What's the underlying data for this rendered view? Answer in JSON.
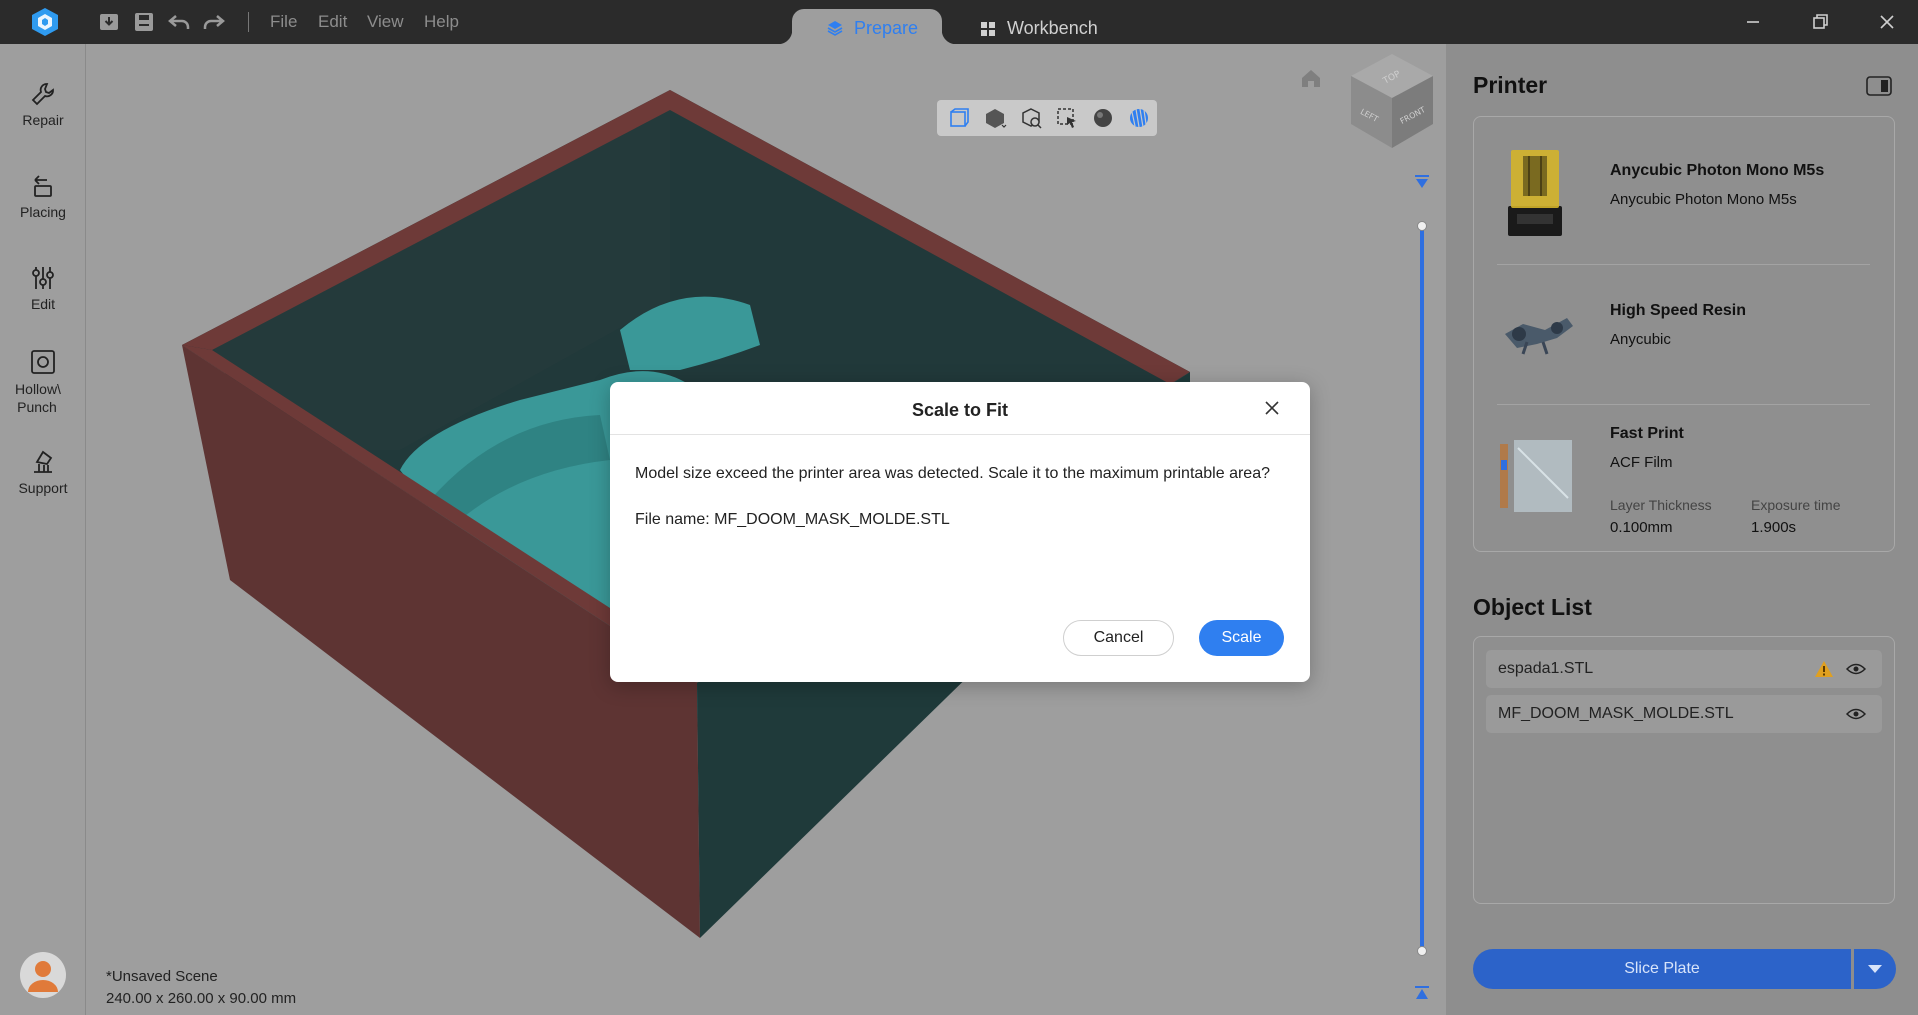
{
  "titlebar": {
    "menus": [
      "File",
      "Edit",
      "View",
      "Help"
    ],
    "tabs": {
      "prepare": "Prepare",
      "workbench": "Workbench"
    }
  },
  "left_tools": [
    {
      "label": "Repair",
      "icon": "wrench-icon"
    },
    {
      "label": "Placing",
      "icon": "placing-icon"
    },
    {
      "label": "Edit",
      "icon": "sliders-icon"
    },
    {
      "label": "Hollow\\",
      "label2": "Punch",
      "icon": "hollow-punch-icon"
    },
    {
      "label": "Support",
      "icon": "support-icon"
    }
  ],
  "viewport": {
    "view_cube": {
      "top": "TOP",
      "left": "LEFT",
      "front": "FRONT"
    },
    "scene_name": "*Unsaved Scene",
    "scene_size": "240.00 x 260.00 x 90.00 mm"
  },
  "printer": {
    "title": "Printer",
    "machine": {
      "name": "Anycubic Photon Mono M5s",
      "sub": "Anycubic Photon Mono M5s"
    },
    "resin": {
      "name": "High Speed Resin",
      "sub": "Anycubic"
    },
    "profile": {
      "name": "Fast Print",
      "sub": "ACF Film",
      "layer_label": "Layer Thickness",
      "layer_value": "0.100mm",
      "exposure_label": "Exposure time",
      "exposure_value": "1.900s"
    }
  },
  "object_list": {
    "title": "Object List",
    "items": [
      {
        "name": "espada1.STL",
        "warning": true
      },
      {
        "name": "MF_DOOM_MASK_MOLDE.STL",
        "warning": false
      }
    ]
  },
  "slice": {
    "label": "Slice Plate"
  },
  "dialog": {
    "title": "Scale to Fit",
    "message": "Model size exceed the printer area was detected. Scale it to the maximum printable area?",
    "file_line": "File name: MF_DOOM_MASK_MOLDE.STL",
    "cancel": "Cancel",
    "confirm": "Scale"
  },
  "colors": {
    "accent": "#2f7ff0",
    "box_wall": "#5e3433",
    "mask": "#3a9898",
    "warning": "#e0a020"
  }
}
